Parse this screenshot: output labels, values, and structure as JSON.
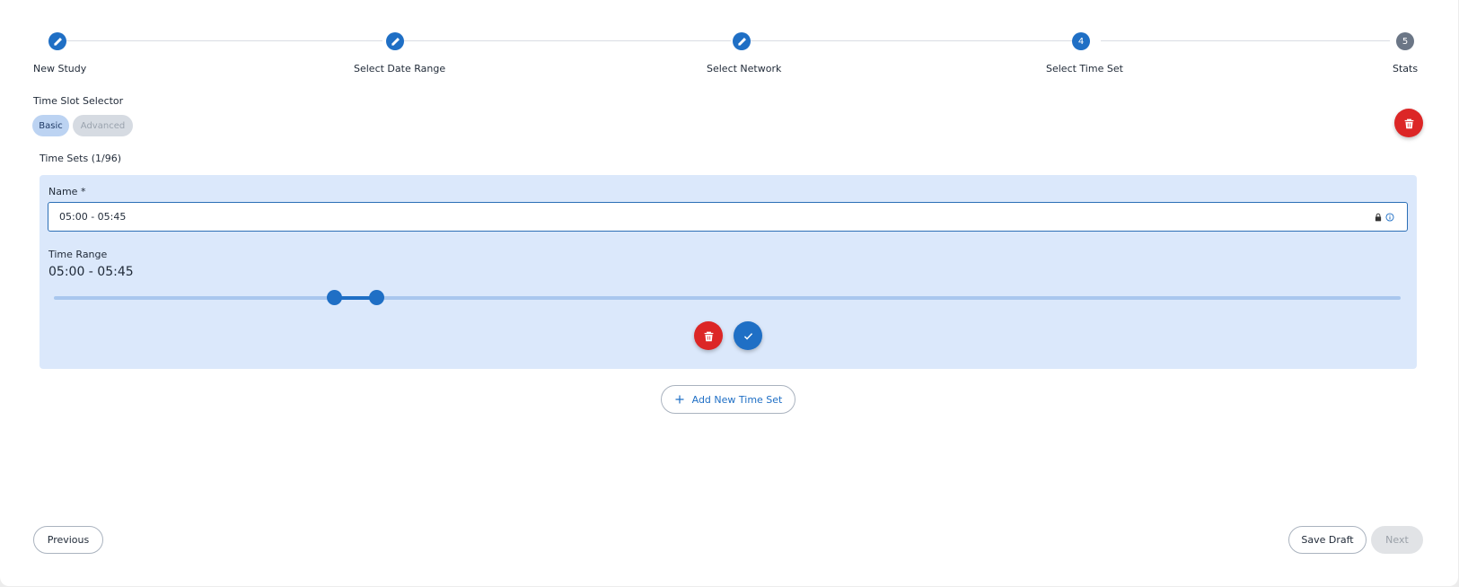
{
  "stepper": {
    "steps": [
      {
        "label": "New Study",
        "state": "completed",
        "icon": "pencil-icon"
      },
      {
        "label": "Select Date Range",
        "state": "completed",
        "icon": "pencil-icon"
      },
      {
        "label": "Select Network",
        "state": "completed",
        "icon": "pencil-icon"
      },
      {
        "label": "Select Time Set",
        "state": "active",
        "number": "4"
      },
      {
        "label": "Stats",
        "state": "pending",
        "number": "5"
      }
    ]
  },
  "selector": {
    "title": "Time Slot Selector",
    "basic_label": "Basic",
    "advanced_label": "Advanced",
    "selected": "Basic"
  },
  "time_sets": {
    "title": "Time Sets (1/96)",
    "name_label": "Name *",
    "name_value": "05:00 - 05:45",
    "range_label": "Time Range",
    "range_value": "05:00 - 05:45",
    "slider": {
      "min": "00:00",
      "max": "24:00",
      "start_fraction": 0.2083,
      "end_fraction": 0.2396
    }
  },
  "actions": {
    "add_new_label": "Add New Time Set",
    "previous_label": "Previous",
    "save_draft_label": "Save Draft",
    "next_label": "Next"
  },
  "colors": {
    "primary": "#1f6fc5",
    "danger": "#dc2626",
    "card_bg": "#dbe8fb",
    "pending_step": "#6b7686"
  }
}
